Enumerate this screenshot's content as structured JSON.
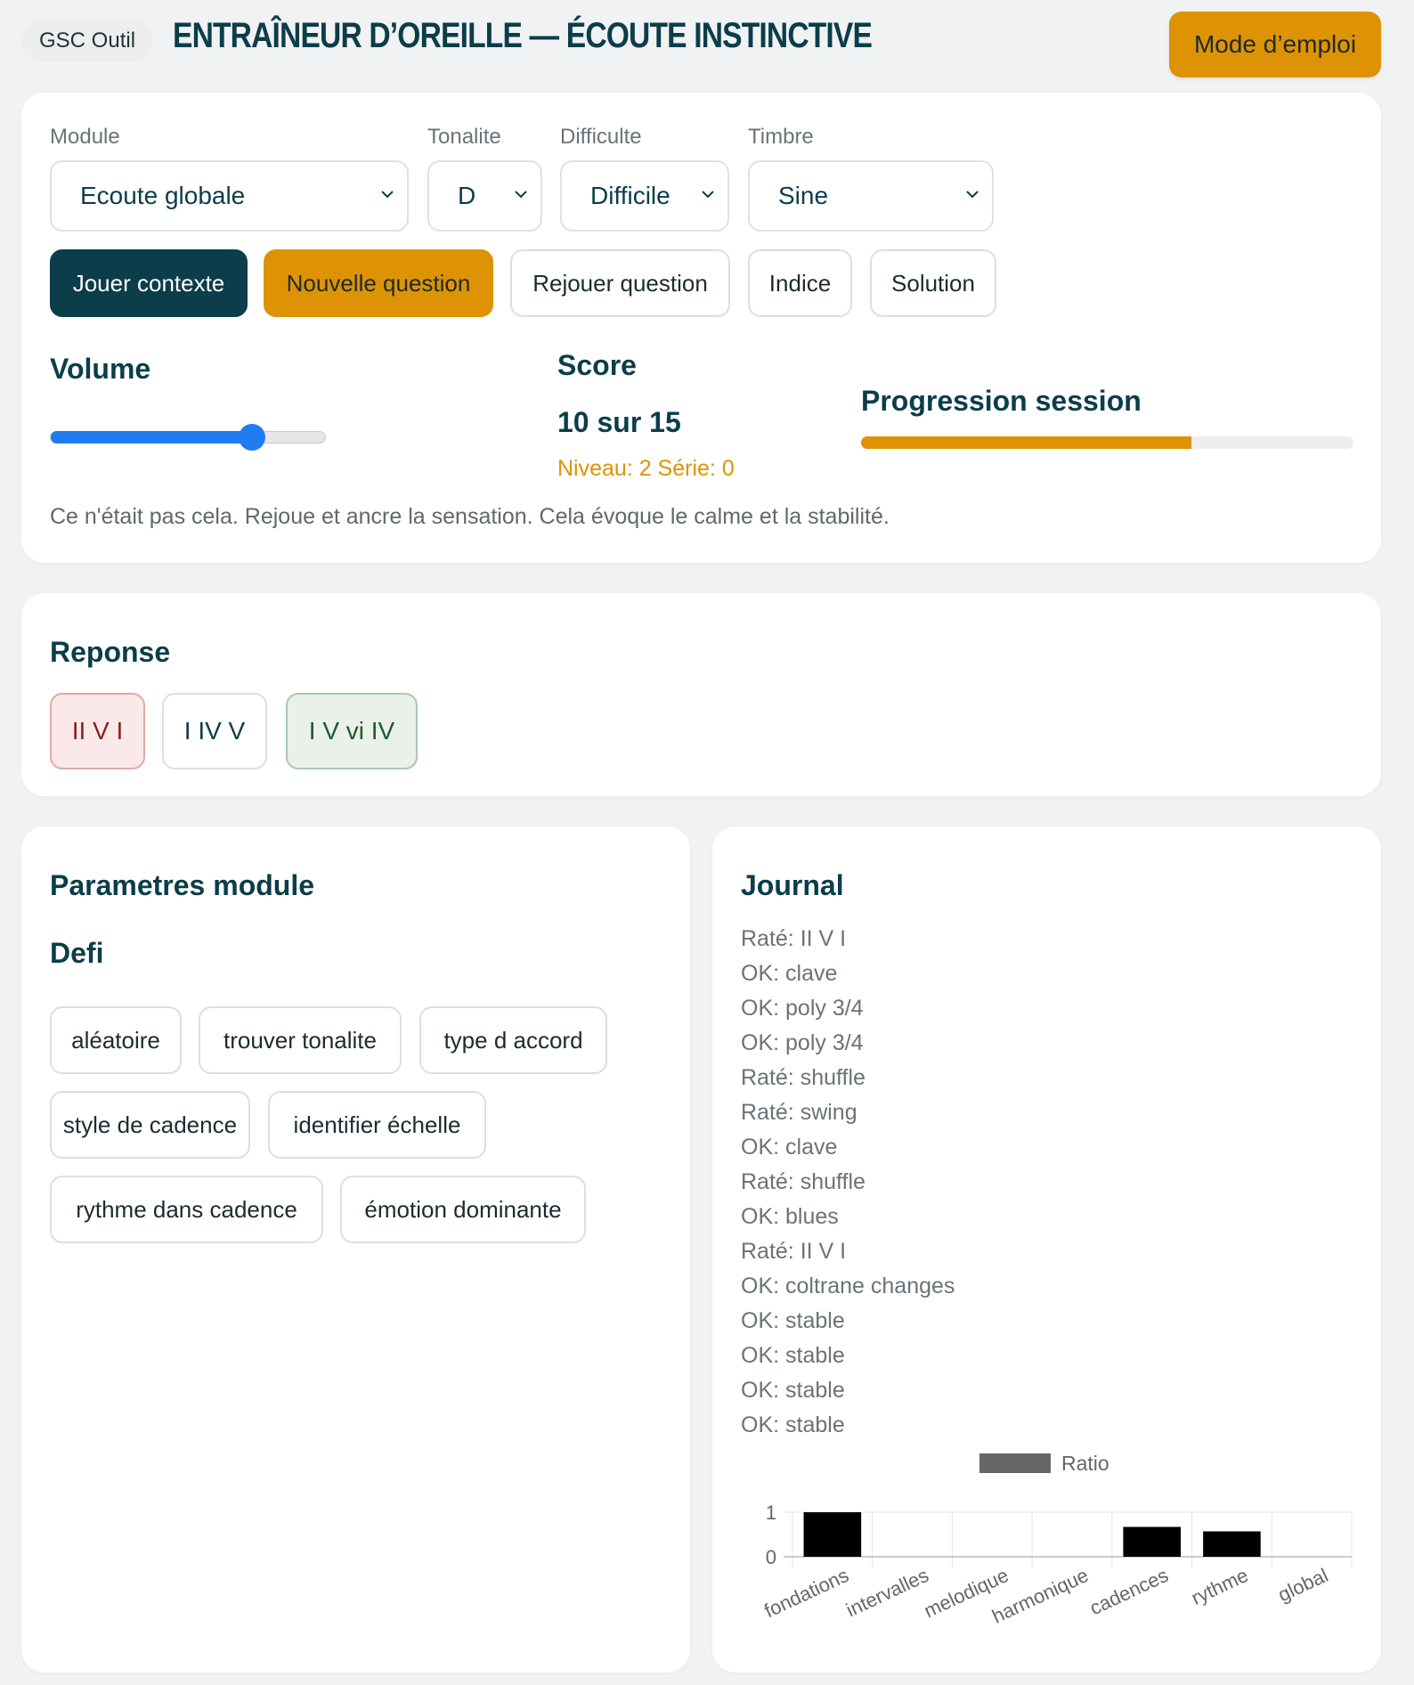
{
  "header": {
    "tool_chip": "GSC Outil",
    "title": "Entraîneur d’oreille — Écoute instinctive",
    "help_button": "Mode d’emploi"
  },
  "controls": {
    "module": {
      "label": "Module",
      "value": "Ecoute globale"
    },
    "tonalite": {
      "label": "Tonalite",
      "value": "D"
    },
    "difficulte": {
      "label": "Difficulte",
      "value": "Difficile"
    },
    "timbre": {
      "label": "Timbre",
      "value": "Sine"
    },
    "buttons": {
      "play_context": "Jouer contexte",
      "new_question": "Nouvelle question",
      "replay_question": "Rejouer question",
      "hint": "Indice",
      "solution": "Solution"
    },
    "volume": {
      "label": "Volume",
      "level_percent": 73
    },
    "score": {
      "label": "Score",
      "value": "10 sur 15",
      "level_line": "Niveau: 2 Série: 0"
    },
    "progress": {
      "label": "Progression session",
      "percent": 67
    },
    "feedback": "Ce n'était pas cela. Rejoue et ancre la sensation. Cela évoque le calme et la stabilité."
  },
  "answer": {
    "title": "Reponse",
    "options": [
      {
        "label": "II V I",
        "state": "wrong"
      },
      {
        "label": "I IV V",
        "state": "neutral"
      },
      {
        "label": "I V vi IV",
        "state": "correct"
      }
    ]
  },
  "params": {
    "title": "Parametres module",
    "subtitle": "Defi",
    "challenges": [
      "aléatoire",
      "trouver tonalite",
      "type d accord",
      "style de cadence",
      "identifier échelle",
      "rythme dans cadence",
      "émotion dominante"
    ]
  },
  "journal": {
    "title": "Journal",
    "entries": [
      "Raté: II V I",
      "OK: clave",
      "OK: poly 3/4",
      "OK: poly 3/4",
      "Raté: shuffle",
      "Raté: swing",
      "OK: clave",
      "Raté: shuffle",
      "OK: blues",
      "Raté: II V I",
      "OK: coltrane changes",
      "OK: stable",
      "OK: stable",
      "OK: stable",
      "OK: stable"
    ]
  },
  "chart_data": {
    "type": "bar",
    "categories": [
      "fondations",
      "intervalles",
      "melodique",
      "harmonique",
      "cadences",
      "rythme",
      "global"
    ],
    "series": [
      {
        "name": "Ratio",
        "values": [
          1,
          0,
          0,
          0,
          0.67,
          0.57,
          0
        ]
      }
    ],
    "ylim": [
      0,
      1
    ],
    "yticks": [
      "0",
      "1"
    ],
    "legend": "top",
    "colors": {
      "bar": "#000000",
      "legend_swatch": "#666666"
    },
    "grid": true
  },
  "colors": {
    "primary": "#0b3d4a",
    "accent": "#dd9304",
    "slider": "#1f7cf2"
  }
}
